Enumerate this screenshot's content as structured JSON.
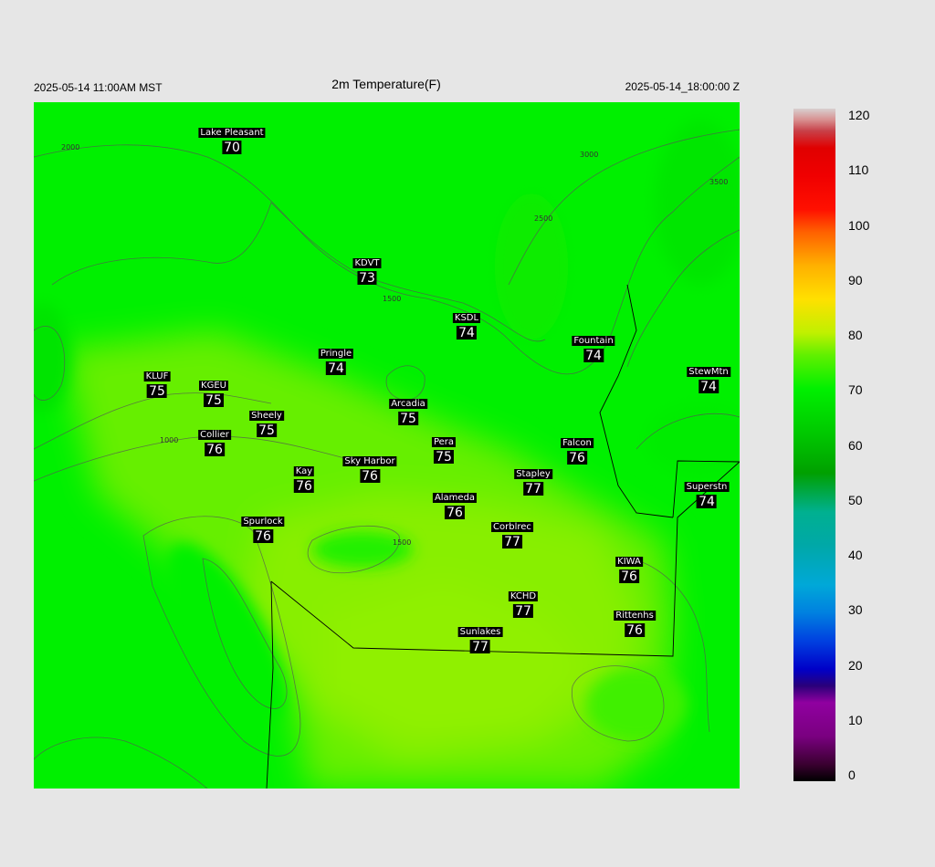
{
  "header": {
    "title": "2m Temperature(F)",
    "local_time": "2025-05-14 11:00AM MST",
    "valid_time": "2025-05-14_18:00:00 Z"
  },
  "colors": {
    "background": "#e6e6e6",
    "green_bright": "#00f000",
    "green_yellow": "#90f000",
    "label_bg": "#000000"
  },
  "contour_labels": [
    "2000",
    "3000",
    "2500",
    "3500",
    "1500",
    "1000"
  ],
  "stations": [
    {
      "name": "Lake Pleasant",
      "temp": "70"
    },
    {
      "name": "KDVT",
      "temp": "73"
    },
    {
      "name": "KSDL",
      "temp": "74"
    },
    {
      "name": "Fountain",
      "temp": "74"
    },
    {
      "name": "Pringle",
      "temp": "74"
    },
    {
      "name": "KLUF",
      "temp": "75"
    },
    {
      "name": "KGEU",
      "temp": "75"
    },
    {
      "name": "Arcadia",
      "temp": "75"
    },
    {
      "name": "StewMtn",
      "temp": "74"
    },
    {
      "name": "Sheely",
      "temp": "75"
    },
    {
      "name": "Collier",
      "temp": "76"
    },
    {
      "name": "Pera",
      "temp": "75"
    },
    {
      "name": "Falcon",
      "temp": "76"
    },
    {
      "name": "Sky Harbor",
      "temp": "76"
    },
    {
      "name": "Kay",
      "temp": "76"
    },
    {
      "name": "Stapley",
      "temp": "77"
    },
    {
      "name": "Superstn",
      "temp": "74"
    },
    {
      "name": "Alameda",
      "temp": "76"
    },
    {
      "name": "Spurlock",
      "temp": "76"
    },
    {
      "name": "Corblrec",
      "temp": "77"
    },
    {
      "name": "KIWA",
      "temp": "76"
    },
    {
      "name": "KCHD",
      "temp": "77"
    },
    {
      "name": "Rittenhs",
      "temp": "76"
    },
    {
      "name": "Sunlakes",
      "temp": "77"
    }
  ],
  "colorbar": {
    "ticks": [
      "120",
      "110",
      "100",
      "90",
      "80",
      "70",
      "60",
      "50",
      "40",
      "30",
      "20",
      "10",
      "0"
    ],
    "min": 0,
    "max": 120
  }
}
